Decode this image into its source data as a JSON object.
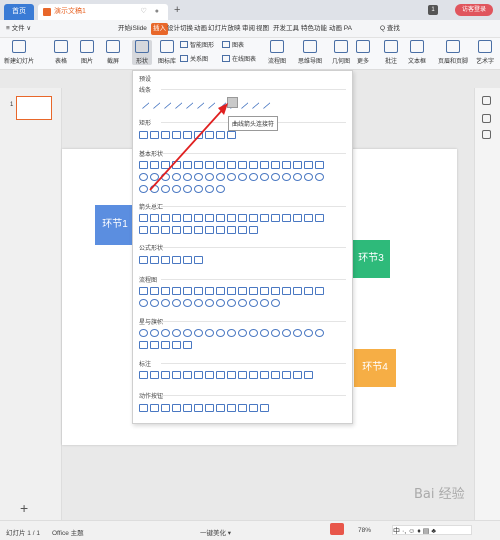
{
  "titlebar": {
    "home_tab": "首页",
    "doc_tab": "演示文稿1",
    "tab_controls": "♡ ●",
    "add_tab": "+",
    "badge": "1",
    "login": "访客登录"
  },
  "menubar": {
    "file": "≡ 文件 ∨",
    "items": [
      "开始",
      "iSlide",
      "插入",
      "设计",
      "切换",
      "动画",
      "幻灯片放映",
      "审阅",
      "视图",
      "开发工具",
      "特色功能",
      "动画 PA"
    ],
    "active_index": 2,
    "search": "Q 查找"
  },
  "ribbon": {
    "big": [
      "新建幻灯片",
      "表格",
      "图片",
      "截屏",
      "形状",
      "图标库",
      "关系图",
      "批注",
      "文本框",
      "页眉和页脚",
      "艺术字"
    ],
    "small": [
      "智能图形",
      "图表",
      "在线图表",
      "流程图",
      "思维导图",
      "几何图",
      "更多"
    ]
  },
  "shapes_panel": {
    "header": "预设",
    "sections": [
      "线条",
      "矩形",
      "基本形状",
      "箭头总汇",
      "公式形状",
      "流程图",
      "星与旗帜",
      "标注",
      "动作按钮"
    ],
    "tooltip": "曲线箭头连接符"
  },
  "slide": {
    "box1": "环节1",
    "box3": "环节3",
    "box4": "环节4"
  },
  "left": {
    "slide_num": "1",
    "add": "+"
  },
  "statusbar": {
    "slide_info": "幻灯片 1 / 1",
    "theme": "Office 主题",
    "beautify": "一键美化 ▾",
    "zoom": "78%",
    "ime": "中 ·, ☺ ♦ ▤ ♣"
  },
  "watermark": "Bai 经验",
  "colors": {
    "accent": "#e8672a",
    "box1": "#5b8ee0",
    "box3": "#2eba7a",
    "box4": "#f6ae45",
    "home": "#3a7bd5"
  }
}
